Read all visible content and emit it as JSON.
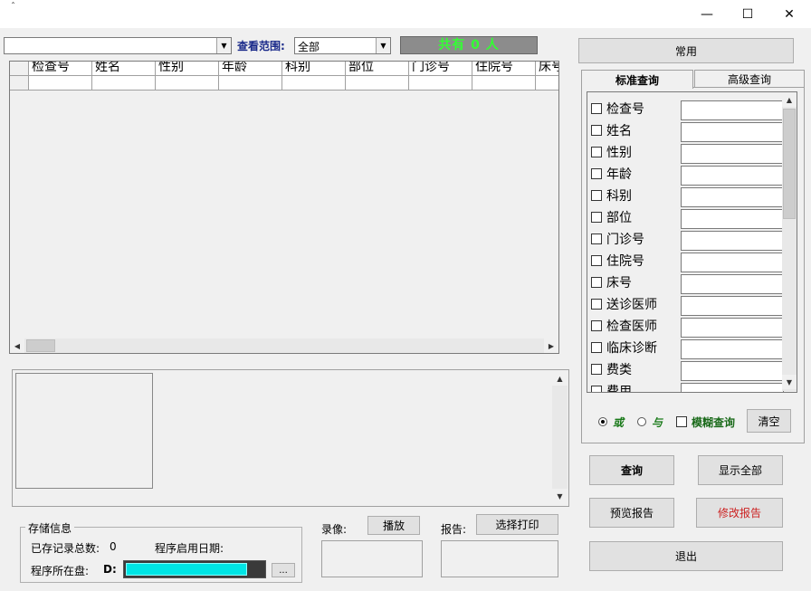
{
  "titlebar": {
    "glyph": "ˆ",
    "minimize": "—",
    "maximize": "☐",
    "close": "✕"
  },
  "toolbar": {
    "filter_value": "",
    "scope_label": "查看范围:",
    "scope_value": "全部",
    "count_text": "共有 0 人"
  },
  "grid": {
    "columns": [
      "检查号",
      "姓名",
      "性别",
      "年龄",
      "科别",
      "部位",
      "门诊号",
      "住院号",
      "床号"
    ]
  },
  "storage": {
    "title": "存储信息",
    "total_label": "已存记录总数:",
    "total_value": "0",
    "start_date_label": "程序启用日期:",
    "start_date_value": "",
    "disk_label": "程序所在盘:",
    "disk_value": "D:",
    "disk_usage": 0.88,
    "browse_label": "..."
  },
  "media": {
    "record_label": "录像:",
    "play_label": "播放",
    "report_label": "报告:",
    "select_print_label": "选择打印"
  },
  "right": {
    "common_label": "常用",
    "tabs": [
      "标准查询",
      "高级查询"
    ],
    "fields": [
      "检查号",
      "姓名",
      "性别",
      "年龄",
      "科别",
      "部位",
      "门诊号",
      "住院号",
      "床号",
      "送诊医师",
      "检查医师",
      "临床诊断",
      "费类",
      "费用"
    ],
    "or_label": "或",
    "and_label": "与",
    "fuzzy_label": "模糊查询",
    "clear_label": "清空"
  },
  "actions": {
    "query": "查询",
    "show_all": "显示全部",
    "preview": "预览报告",
    "modify": "修改报告",
    "exit": "退出"
  },
  "colors": {
    "count_text": "#33ff33",
    "modify_text": "#cc2222",
    "progress": "#00e5e5"
  }
}
